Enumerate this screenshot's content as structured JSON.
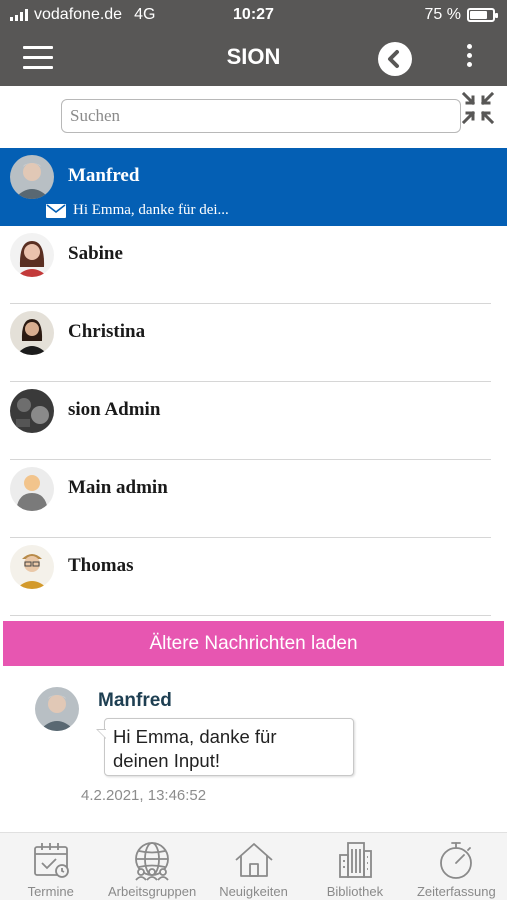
{
  "status_bar": {
    "carrier": "vodafone.de",
    "network": "4G",
    "time": "10:27",
    "battery": "75 %",
    "battery_level": 0.75
  },
  "header": {
    "title": "SION",
    "back_icon": "chevron-left-icon",
    "menu_icon": "hamburger-menu-icon",
    "more_icon": "kebab-menu-icon"
  },
  "search": {
    "placeholder": "Suchen",
    "value": ""
  },
  "contacts": [
    {
      "name": "Manfred",
      "preview": "Hi Emma, danke für dei...",
      "active": true
    },
    {
      "name": "Sabine"
    },
    {
      "name": "Christina"
    },
    {
      "name": "sion Admin"
    },
    {
      "name": "Main admin"
    },
    {
      "name": "Thomas"
    }
  ],
  "load_older_label": "Ältere Nachrichten laden",
  "message": {
    "sender": "Manfred",
    "text_line1": "Hi Emma, danke für",
    "text_line2": "deinen Input!",
    "timestamp": "4.2.2021, 13:46:52"
  },
  "bottom_nav": [
    {
      "label": "Termine",
      "icon": "calendar-icon"
    },
    {
      "label": "Arbeitsgruppen",
      "icon": "group-globe-icon"
    },
    {
      "label": "Neuigkeiten",
      "icon": "home-icon"
    },
    {
      "label": "Bibliothek",
      "icon": "building-icon"
    },
    {
      "label": "Zeiterfassung",
      "icon": "stopwatch-icon"
    }
  ],
  "colors": {
    "header_bg": "#585756",
    "active_contact_bg": "#045fb4",
    "load_older_bg": "#e756b1",
    "sender_name": "#1e3f52"
  }
}
